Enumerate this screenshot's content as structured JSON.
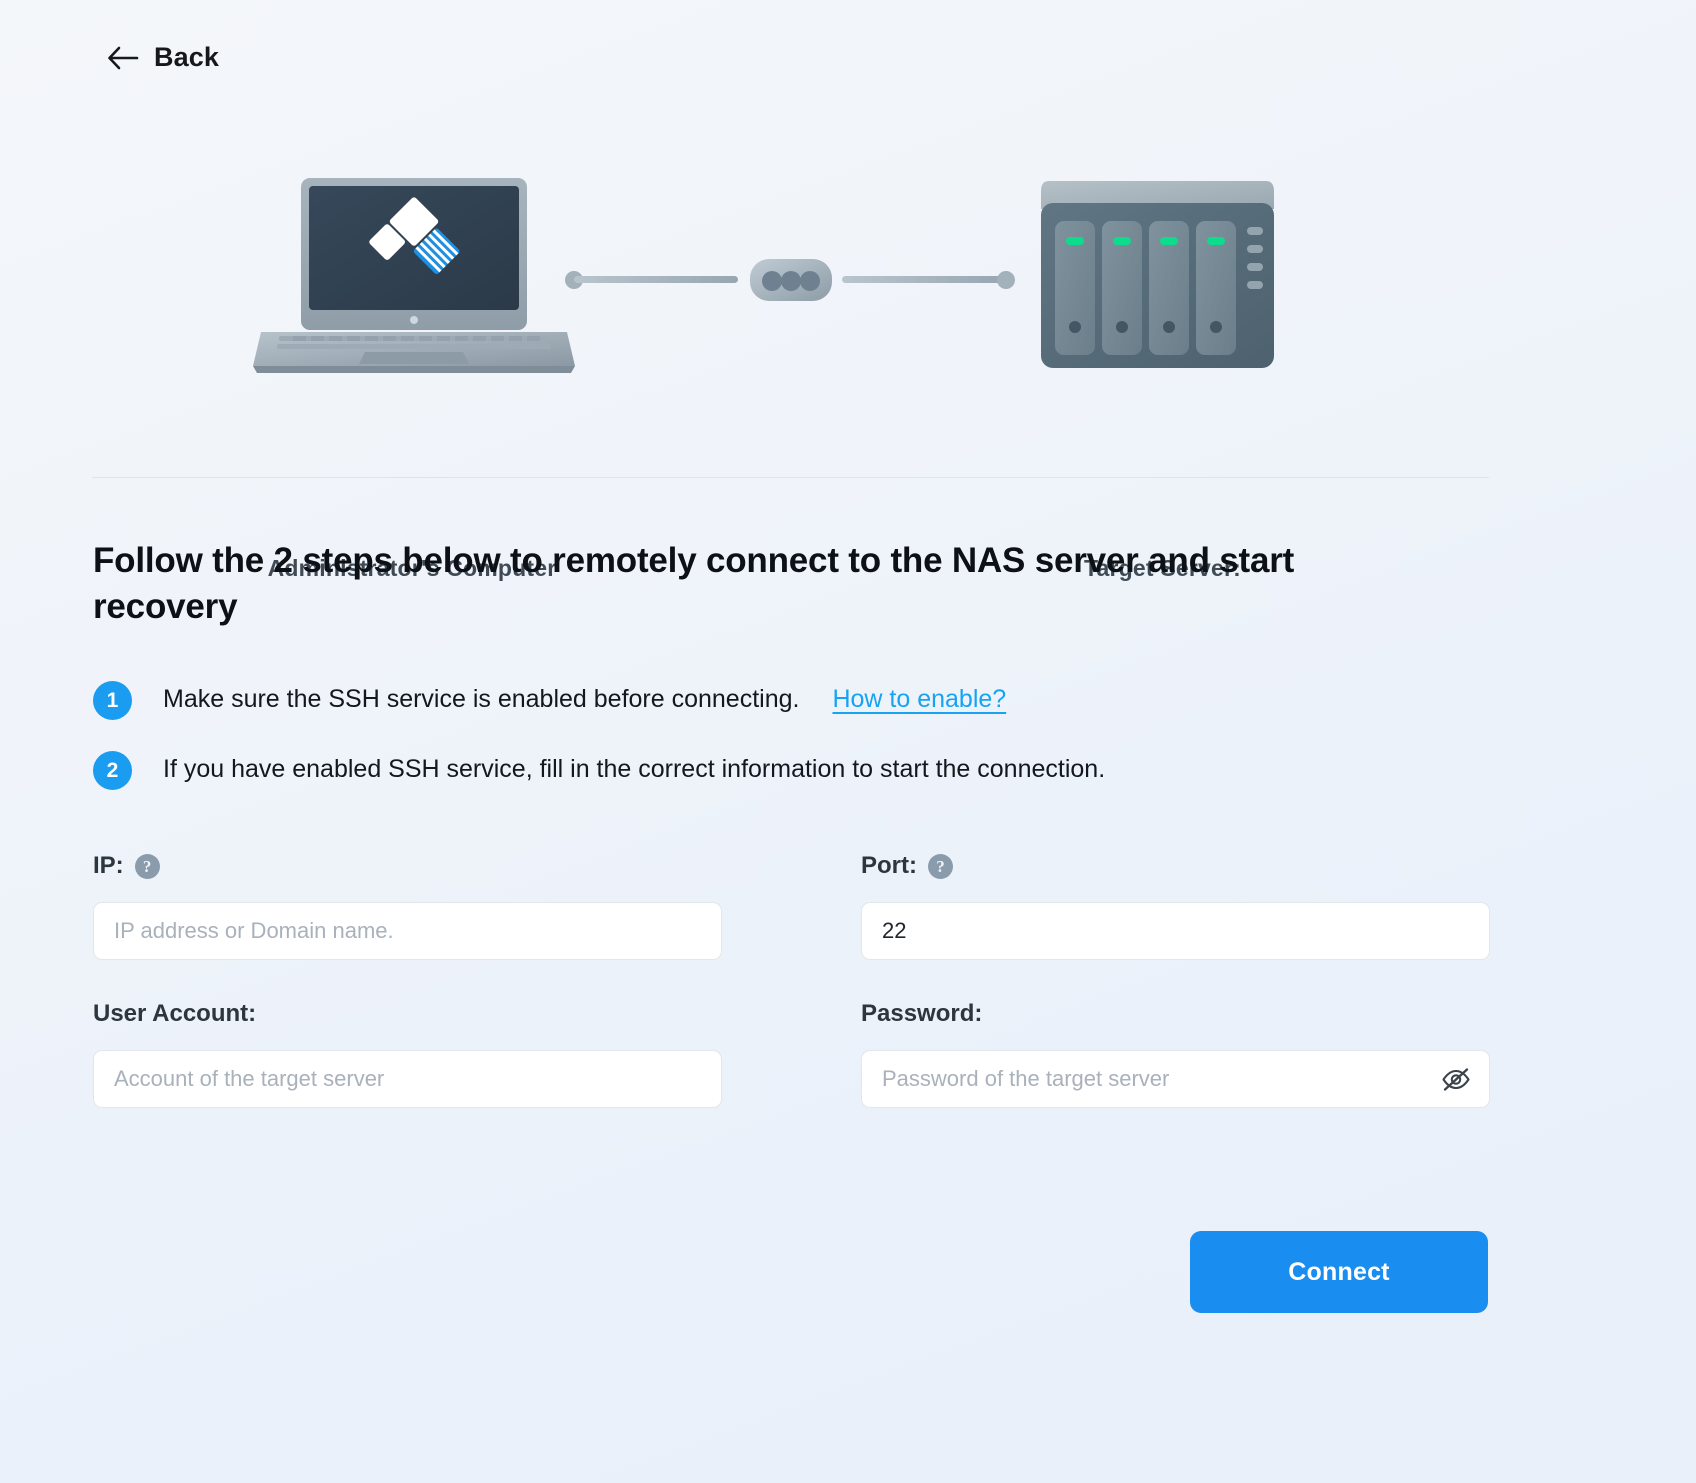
{
  "nav": {
    "back_label": "Back",
    "back_icon": "arrow-left-icon"
  },
  "illustration": {
    "left_caption": "Administrator's Computer",
    "right_caption": "Target Server:",
    "left_icon": "laptop-icon",
    "right_icon": "nas-server-icon",
    "connector_icon": "connector-icon",
    "accent_blue": "#1a8ef0",
    "led_green": "#0ddc8c",
    "screen_dark": "#2f3e4c"
  },
  "heading": "Follow the 2 steps below to remotely connect to the NAS server and start recovery",
  "steps": [
    {
      "number": "1",
      "text": "Make sure the SSH service is enabled before connecting.",
      "link": "How to enable?"
    },
    {
      "number": "2",
      "text": "If you have enabled SSH service, fill in the correct information to start the connection.",
      "link": ""
    }
  ],
  "form": {
    "ip": {
      "label": "IP:",
      "help_icon": "question-mark-icon",
      "placeholder": "IP address or Domain name.",
      "value": ""
    },
    "port": {
      "label": "Port:",
      "help_icon": "question-mark-icon",
      "placeholder": "",
      "value": "22"
    },
    "user_account": {
      "label": "User Account:",
      "placeholder": "Account of the target server",
      "value": ""
    },
    "password": {
      "label": "Password:",
      "placeholder": "Password of the target server",
      "value": "",
      "toggle_icon": "eye-off-icon"
    }
  },
  "actions": {
    "connect_label": "Connect",
    "connect_color": "#1a8ef0"
  }
}
